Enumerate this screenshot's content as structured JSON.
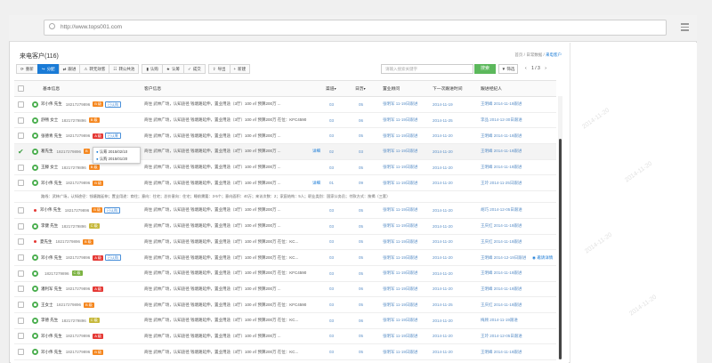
{
  "browser": {
    "url": "http://www.tops001.com"
  },
  "page": {
    "title": "来电客户(116)",
    "breadcrumb": [
      "首页",
      "/",
      "日常数据",
      "/",
      "来电客户"
    ]
  },
  "toolbar": {
    "buttons": [
      {
        "label": "重新",
        "icon": "refresh-icon"
      },
      {
        "label": "分配",
        "icon": "share-icon",
        "active": true
      },
      {
        "label": "跟进",
        "icon": "transfer-icon"
      },
      {
        "label": "转无效客",
        "icon": "warning-icon"
      },
      {
        "label": "转公共池",
        "icon": "users-icon"
      },
      {
        "label": "认购",
        "icon": "bookmark-icon"
      },
      {
        "label": "认筹",
        "icon": "star-icon"
      },
      {
        "label": "成交",
        "icon": "thumbs-up-icon"
      },
      {
        "label": "导出",
        "icon": "export-icon"
      },
      {
        "label": "新建",
        "icon": "plus-icon"
      }
    ],
    "search_placeholder": "请输入搜索关键字",
    "search_button": "搜索",
    "filter_button": "筛选",
    "pager": {
      "prev": "‹",
      "text": "1 / 3",
      "next": "›"
    }
  },
  "table": {
    "columns": [
      "基本信息",
      "客户信息",
      "渠道",
      "日历",
      "置业顾问",
      "下一次跟进时间",
      "跟进经纪人"
    ],
    "rows": [
      {
        "name": "邓小伟 先生",
        "phone": "18217279896",
        "tags": [
          {
            "t": "B 级",
            "c": "orange"
          },
          {
            "t": "已认购",
            "c": "outline"
          }
        ],
        "info": "商住 武林广场，认知途径 钱塘路延伸，置业用途（3厅）100 ㎡ 预算200万 ...",
        "ch": "03",
        "day": "05",
        "adv": "张明军 11-19日跟进",
        "next": "2014-11-19",
        "agent": "王明峰 2014-11-19跟进",
        "icon": "green"
      },
      {
        "name": "舒畅 女士",
        "phone": "18217279896",
        "tags": [
          {
            "t": "B 级",
            "c": "orange"
          }
        ],
        "info": "商住 武林广场，认知途径 钱塘路延伸，置业用途（3厅）100 ㎡ 预算200万 在位：KFC4590",
        "ch": "03",
        "day": "06",
        "adv": "张明军 11-19日跟进",
        "next": "2014-11-25",
        "agent": "李品 2014-12-30日跟进",
        "icon": "green"
      },
      {
        "name": "张德青 先生",
        "phone": "18217279896",
        "tags": [
          {
            "t": "A 级",
            "c": "red"
          },
          {
            "t": "已认筹",
            "c": "outline"
          }
        ],
        "info": "商住 武林广场，认知途径 钱塘路延伸，置业用途（3厅）100 ㎡ 预算200万 ...",
        "ch": "03",
        "day": "05",
        "adv": "张明军 11-19日跟进",
        "next": "2014-11-20",
        "agent": "王明峰 2014-11-19跟进",
        "icon": "green"
      },
      {
        "name": "葛先生",
        "phone": "18217279896",
        "tags": [
          {
            "t": "B",
            "c": "orange"
          }
        ],
        "info": "商住 武林广场，认知途径 钱塘路延伸，置业用途（3厅）100 ㎡ 预算200万 ...",
        "link": "详细",
        "ch": "02",
        "day": "03",
        "adv": "张明军 11-19日跟进",
        "next": "2014-11-20",
        "agent": "王明峰 2014-11-19跟进",
        "icon": "check",
        "selected": true
      },
      {
        "name": "王滕 女士",
        "phone": "18217279896",
        "tags": [
          {
            "t": "B 级",
            "c": "orange"
          }
        ],
        "info": "商住 武林广场，认知途径 钱塘路延伸，置业用途（3厅）100 ㎡ 预算200万 ...",
        "ch": "03",
        "day": "05",
        "adv": "张明军 11-19日跟进",
        "next": "2014-11-20",
        "agent": "王明峰 2014-11-19跟进",
        "icon": "green"
      },
      {
        "name": "邓小伟 先生",
        "phone": "18217279896",
        "tags": [
          {
            "t": "B 级",
            "c": "orange"
          }
        ],
        "info": "商住 武林广场，认知途径 钱塘路延伸，置业用途（3厅）100 ㎡ 预算200万 ...",
        "link": "详细",
        "ch": "01",
        "day": "09",
        "adv": "张明军 11-19日跟进",
        "next": "2014-11-20",
        "agent": "王玲 2014-11-25日跟进",
        "icon": "green",
        "expanded": true
      },
      {
        "name": "邓小伟 先生",
        "phone": "18217279896",
        "tags": [
          {
            "t": "B 级",
            "c": "orange"
          },
          {
            "t": "已认购",
            "c": "outline"
          }
        ],
        "info": "商住 武林广场，认知途径 钱塘路延伸，置业用途（3厅）100 ㎡ 预算200万 ...",
        "ch": "03",
        "day": "05",
        "adv": "张明军 11-19日跟进",
        "next": "2014-11-20",
        "agent": "胡巧 2014-12-05日跟进",
        "icon": "dot"
      },
      {
        "name": "李健 先生",
        "phone": "18217279896",
        "tags": [
          {
            "t": "C 级",
            "c": "olive"
          }
        ],
        "info": "商住 武林广场，认知途径 钱塘路延伸，置业用途（3厅）100 ㎡ 预算200万 ...",
        "ch": "03",
        "day": "05",
        "adv": "张明军 11-19日跟进",
        "next": "2014-11-20",
        "agent": "王庆红 2014-11-19跟进",
        "icon": "green"
      },
      {
        "name": "夏先生",
        "phone": "18217279896",
        "tags": [
          {
            "t": "B 级",
            "c": "orange"
          }
        ],
        "info": "商住 武林广场，认知途径 钱塘路延伸，置业用途（3厅）100 ㎡ 预算200万 在位：KC...",
        "ch": "03",
        "day": "05",
        "adv": "张明军 11-19日跟进",
        "next": "2014-11-20",
        "agent": "王庆红 2014-11-19跟进",
        "icon": "dot"
      },
      {
        "name": "邓小伟 先生",
        "phone": "18217279896",
        "tags": [
          {
            "t": "A 级",
            "c": "red"
          },
          {
            "t": "已认购",
            "c": "outline"
          }
        ],
        "info": "商住 武林广场，认知途径 钱塘路延伸，置业用途（3厅）100 ㎡ 预算200万 在位：KC...",
        "ch": "03",
        "day": "05",
        "adv": "张明军 11-19日跟进",
        "next": "2014-11-20",
        "agent": "王明峰 2014-12-19日跟进",
        "icon": "green",
        "extra": "邀请详情"
      },
      {
        "name": "",
        "phone": "18217279896",
        "tags": [
          {
            "t": "C 级",
            "c": "green"
          }
        ],
        "info": "商住 武林广场，认知途径 钱塘路延伸，置业用途（3厅）100 ㎡ 预算200万 在位：KFC4590",
        "ch": "03",
        "day": "05",
        "adv": "张明军 11-19日跟进",
        "next": "2014-11-20",
        "agent": "王明峰 2014-11-19跟进",
        "icon": "green"
      },
      {
        "name": "潘利军 先生",
        "phone": "18217279896",
        "tags": [
          {
            "t": "A 级",
            "c": "red"
          }
        ],
        "info": "商住 武林广场，认知途径 钱塘路延伸，置业用途（3厅）100 ㎡ 预算200万 ...",
        "ch": "03",
        "day": "06",
        "adv": "张明军 11-19日跟进",
        "next": "2014-11-20",
        "agent": "王明峰 2014-11-19跟进",
        "icon": "green"
      },
      {
        "name": "王女士",
        "phone": "18217279896",
        "tags": [
          {
            "t": "B 级",
            "c": "orange"
          }
        ],
        "info": "商住 武林广场，认知途径 钱塘路延伸，置业用途（3厅）100 ㎡ 预算200万 在位：KFC4590",
        "ch": "03",
        "day": "05",
        "adv": "张明军 11-19日跟进",
        "next": "2014-11-25",
        "agent": "王庆红 2014-11-19跟进",
        "icon": "green"
      },
      {
        "name": "李德 先生",
        "phone": "18217279896",
        "tags": [
          {
            "t": "C 级",
            "c": "olive"
          }
        ],
        "info": "商住 武林广场，认知途径 钱塘路延伸，置业用途（3厅）100 ㎡ 预算200万 在位：KC...",
        "ch": "03",
        "day": "06",
        "adv": "张明军 11-19日跟进",
        "next": "2014-11-20",
        "agent": "梅顾 2014-11-19跟进",
        "icon": "green"
      },
      {
        "name": "邓小伟 先生",
        "phone": "18217279896",
        "tags": [
          {
            "t": "A 级",
            "c": "red"
          }
        ],
        "info": "商住 武林广场，认知途径 钱塘路延伸，置业用途（3厅）100 ㎡ 预算200万 ...",
        "ch": "03",
        "day": "05",
        "adv": "张明军 11-19日跟进",
        "next": "2014-11-20",
        "agent": "王玲 2014-12-05日跟进",
        "icon": "green"
      },
      {
        "name": "邓小伟 先生",
        "phone": "18217279896",
        "tags": [
          {
            "t": "B 级",
            "c": "orange"
          }
        ],
        "info": "商住 武林广场，认知途径 钱塘路延伸，置业用途（3厅）100 ㎡ 预算200万 在位：KC...",
        "ch": "03",
        "day": "05",
        "adv": "张明军 11-19日跟进",
        "next": "2014-11-20",
        "agent": "王明峰 2014-11-19跟进",
        "icon": "green"
      }
    ],
    "expanded_detail": "路线：武林广场，认知途径：钱塘路延伸；置业用途：商住；意向：住宅；总价意向：住宅；睡前需要：3-5个；意向面积：40万；来访次数：2；家庭结构：5人；职业类别：国家公务员；付款方式：按揭（三套）"
  },
  "popup": {
    "items": [
      "认筹 2015/02/10",
      "认购 2015/01/20"
    ]
  },
  "watermarks": [
    "2014-11-20",
    "2014-11-20",
    "2014-11-20",
    "2014-11-20"
  ]
}
